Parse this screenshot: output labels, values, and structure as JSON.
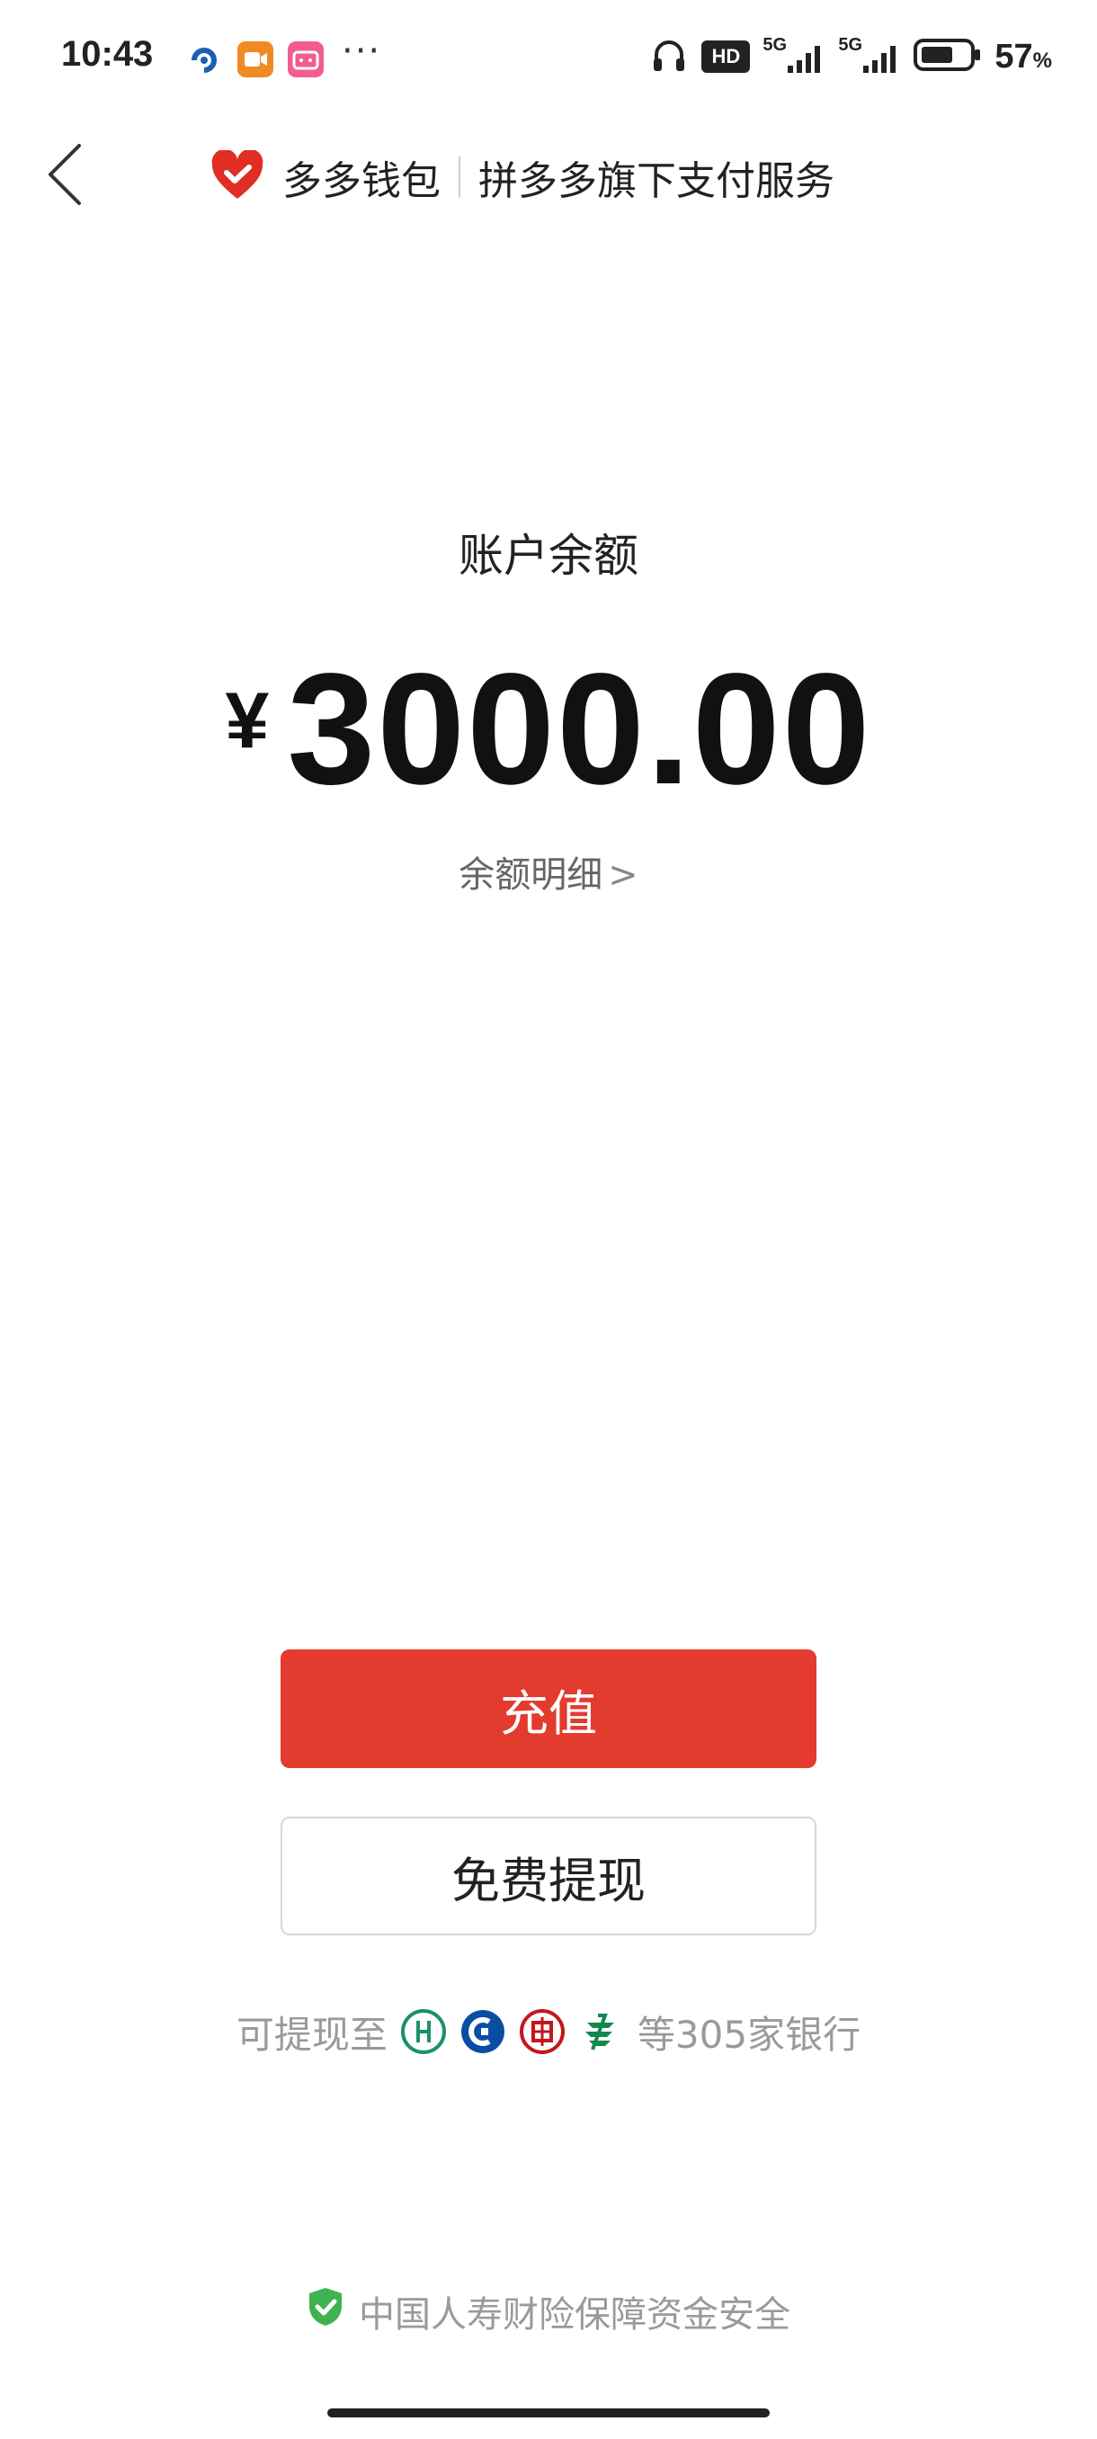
{
  "status_bar": {
    "time": "10:43",
    "more": "···",
    "battery_pct": "57",
    "battery_unit": "%",
    "network1": "5G",
    "network2": "5G",
    "hd": "HD"
  },
  "header": {
    "brand_name": "多多钱包",
    "brand_subtitle": "拼多多旗下支付服务",
    "brand_color": "#e02e24"
  },
  "balance": {
    "label": "账户余额",
    "currency": "¥",
    "amount": "3000.00",
    "detail_link": "余额明细",
    "detail_arrow": ">"
  },
  "actions": {
    "recharge_label": "充值",
    "withdraw_label": "免费提现",
    "recharge_color": "#e33b2e"
  },
  "banks": {
    "prefix": "可提现至",
    "suffix": "等305家银行",
    "logos": [
      "abc-bank-icon",
      "ccb-bank-icon",
      "icbc-bank-icon",
      "postal-bank-icon"
    ]
  },
  "footer": {
    "insurance_text": "中国人寿财险保障资金安全",
    "shield_color": "#3fb34f"
  }
}
